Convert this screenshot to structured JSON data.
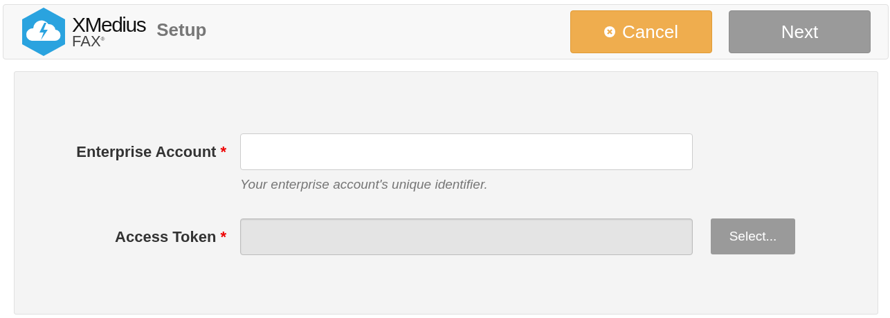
{
  "header": {
    "logo": {
      "name": "XMedius",
      "product": "FAX$^{®}$"
    },
    "title": "Setup",
    "buttons": [
      {
        "kind": "cancel",
        "label": "Cancel",
        "disabled": false
      },
      {
        "kind": "next",
        "label": "Next",
        "disabled": true
      }
    ]
  },
  "form": {
    "fields": [
      {
        "label": "Enterprise Account",
        "required_mark": "*",
        "disabled": false,
        "hint": "Your enterprise account's unique identifier."
      },
      {
        "label": "Access Token",
        "required_mark": "*",
        "disabled": true,
        "button": {
          "label": "Select..."
        }
      }
    ]
  }
}
